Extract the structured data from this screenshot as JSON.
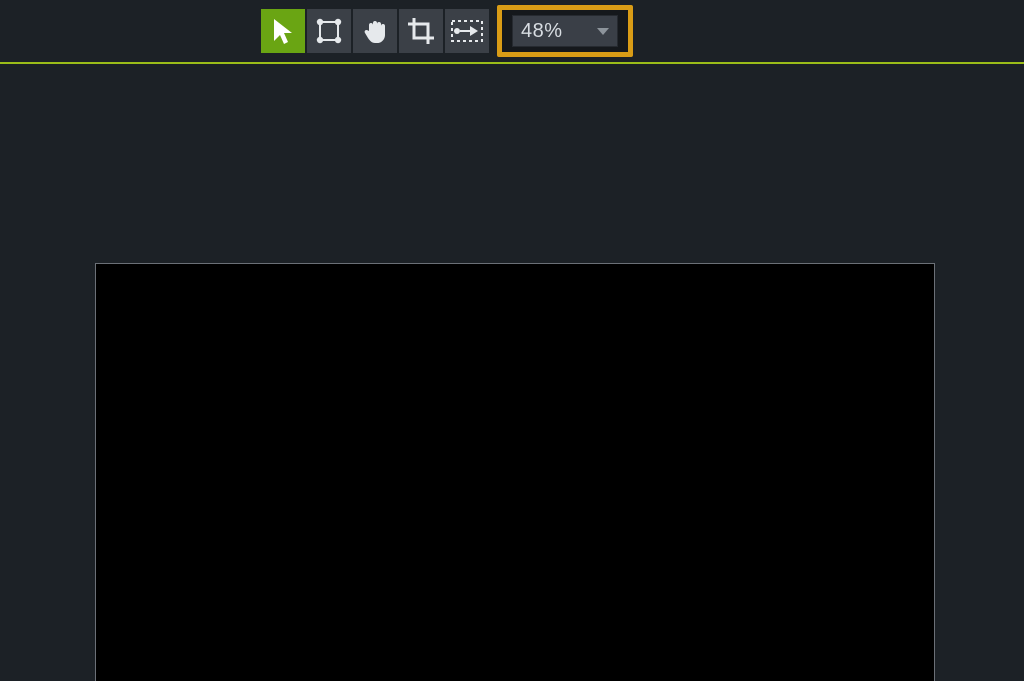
{
  "toolbar": {
    "tools": [
      {
        "name": "edit-pointer-tool",
        "icon": "pointer-icon",
        "active": true
      },
      {
        "name": "vertex-select-tool",
        "icon": "vertex-select-icon",
        "active": false
      },
      {
        "name": "hand-pan-tool",
        "icon": "hand-icon",
        "active": false
      },
      {
        "name": "crop-tool",
        "icon": "crop-icon",
        "active": false
      },
      {
        "name": "motion-path-tool",
        "icon": "motion-path-icon",
        "active": false
      }
    ],
    "zoom": {
      "value": "48%"
    },
    "accent_color": "#9bbd19",
    "highlight_color": "#d99c16"
  },
  "canvas": {
    "background": "#000000"
  }
}
